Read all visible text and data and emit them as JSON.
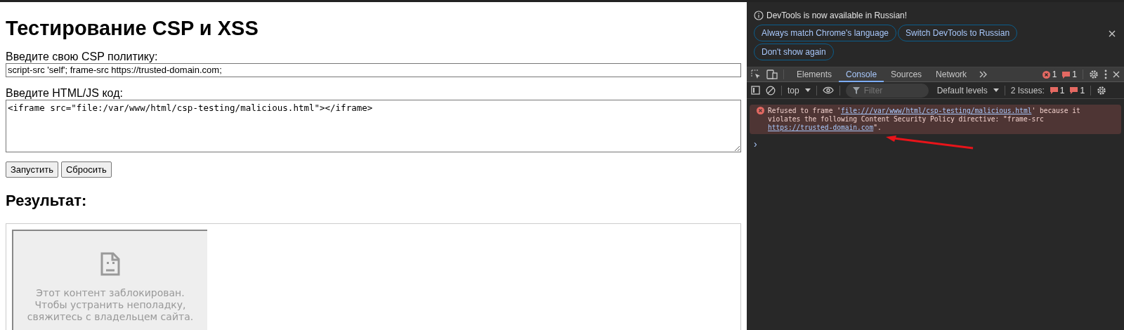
{
  "page": {
    "title": "Тестирование CSP и XSS",
    "csp_label": "Введите свою CSP политику:",
    "csp_value": "script-src 'self'; frame-src https://trusted-domain.com;",
    "code_label": "Введите HTML/JS код:",
    "code_value": "<iframe src=\"file:/var/www/html/csp-testing/malicious.html\"></iframe>",
    "buttons": [
      "Запустить",
      "Сбросить"
    ],
    "result_heading": "Результат:",
    "blocked_lines": [
      "Этот контент заблокирован.",
      "Чтобы устранить неполадку,",
      "свяжитесь с владельцем сайта."
    ]
  },
  "devtools": {
    "banner": {
      "message": "DevTools is now available in Russian!",
      "buttons": [
        "Always match Chrome's language",
        "Switch DevTools to Russian",
        "Don't show again"
      ]
    },
    "tabs": [
      {
        "label": "Elements",
        "selected": false
      },
      {
        "label": "Console",
        "selected": true
      },
      {
        "label": "Sources",
        "selected": false
      },
      {
        "label": "Network",
        "selected": false
      }
    ],
    "error_count": "1",
    "issue_count": "1",
    "toolbar": {
      "context": "top",
      "filter_placeholder": "Filter",
      "levels": "Default levels",
      "issues_label": "2 Issues:",
      "issue_counts": [
        "1",
        "1"
      ]
    },
    "messages": [
      {
        "kind": "error",
        "parts": [
          {
            "text": "Refused to frame '",
            "kind": "text"
          },
          {
            "text": "file:///var/www/html/csp-testing/malicious.html",
            "kind": "link"
          },
          {
            "text": "' because it violates the following Content Security Policy directive: \"frame-src ",
            "kind": "text"
          },
          {
            "text": "https://trusted-domain.com",
            "kind": "link"
          },
          {
            "text": "\".",
            "kind": "text"
          }
        ]
      }
    ],
    "prompt": "›"
  }
}
